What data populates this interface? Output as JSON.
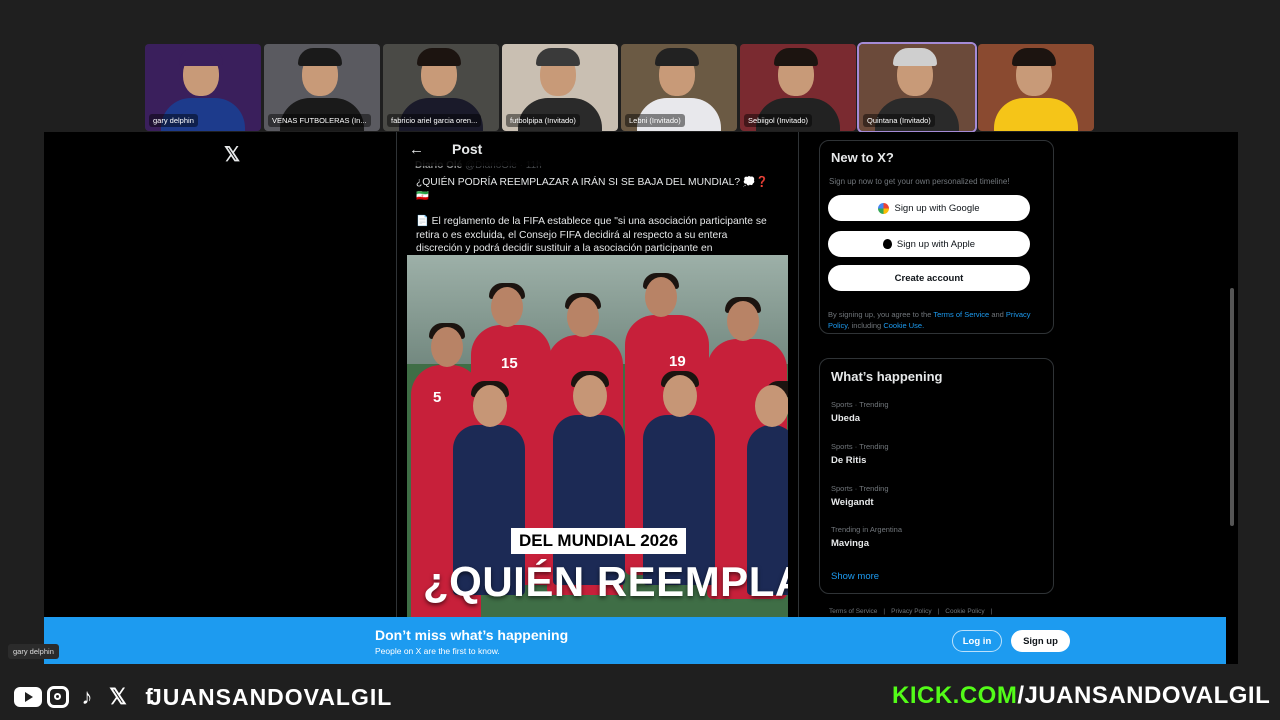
{
  "participants": [
    {
      "name": "gary delphin",
      "bg": "#3a1f5c",
      "shirt": "#1d3b8c",
      "hat": "#3a1f5c"
    },
    {
      "name": "VENAS FUTBOLERAS (In...",
      "bg": "#5a5a60",
      "shirt": "#1a1a1a",
      "hat": "#1a1a1a"
    },
    {
      "name": "fabricio ariel garcia oren...",
      "bg": "#4a4a46",
      "shirt": "#1a1a2a",
      "hat": "#1c1410"
    },
    {
      "name": "futbolpipa (Invitado)",
      "bg": "#c9bfb2",
      "shirt": "#2a2a2a",
      "hat": "#3a3a3a"
    },
    {
      "name": "Lebni (Invitado)",
      "bg": "#6b5a44",
      "shirt": "#e8e8ec",
      "hat": "#222222"
    },
    {
      "name": "Sebiigol (Invitado)",
      "bg": "#7a2a30",
      "shirt": "#222222",
      "hat": "#1c1410"
    },
    {
      "name": "Quintana (Invitado)",
      "bg": "#6b4a3a",
      "shirt": "#2a2a2a",
      "hat": "#cfcfcf"
    },
    {
      "name": "",
      "bg": "#8a4a30",
      "shirt": "#f5c518",
      "hat": "#1c1410"
    }
  ],
  "x": {
    "logo": "𝕏",
    "post_header": {
      "back": "←",
      "title": "Post"
    },
    "author": {
      "name": "Diario Olé",
      "handle": "@DiarioOle · 11h"
    },
    "tweet": {
      "line1": "¿QUIÉN PODRÍA REEMPLAZAR A IRÁN SI SE BAJA DEL MUNDIAL? 💭❓🇮🇷",
      "line2": "📄 El reglamento de la FIFA establece que \"si una asociación participante se retira o es excluida, el Consejo FIFA decidirá al respecto a su entera discreción y podrá decidir sustituir a la asociación participante en"
    },
    "media": {
      "banner": "DEL MUNDIAL 2026",
      "headline": "¿QUIÉN REEMPLAZA",
      "numbers": [
        "5",
        "15",
        "19"
      ]
    },
    "new_to_x": {
      "title": "New to X?",
      "subtitle": "Sign up now to get your own personalized timeline!",
      "google": "Sign up with Google",
      "apple": "Sign up with Apple",
      "create": "Create account",
      "legal_pre": "By signing up, you agree to the",
      "terms": "Terms of Service",
      "legal_and": "and",
      "privacy": "Privacy Policy",
      "legal_incl": ", including",
      "cookie": "Cookie Use."
    },
    "whats_happening": {
      "title": "What’s happening",
      "trends": [
        {
          "category": "Sports · Trending",
          "name": "Ubeda"
        },
        {
          "category": "Sports · Trending",
          "name": "De Ritis"
        },
        {
          "category": "Sports · Trending",
          "name": "Weigandt"
        },
        {
          "category": "Trending in Argentina",
          "name": "Mavinga"
        }
      ],
      "show_more": "Show more"
    },
    "footer_links": [
      "Terms of Service",
      "|",
      "Privacy Policy",
      "|",
      "Cookie Policy",
      "|"
    ],
    "bottom_banner": {
      "title": "Don’t miss what’s happening",
      "subtitle": "People on X are the first to know.",
      "login": "Log in",
      "signup": "Sign up"
    }
  },
  "speaker_tag": "gary delphin",
  "stream": {
    "handle": "JUANSANDOVALGIL",
    "kick_domain": "KICK.COM",
    "kick_path": "/JUANSANDOVALGIL",
    "social_icons": [
      "youtube-icon",
      "instagram-icon",
      "tiktok-icon",
      "x-icon",
      "facebook-icon"
    ],
    "kick_color": "#53fc18"
  }
}
